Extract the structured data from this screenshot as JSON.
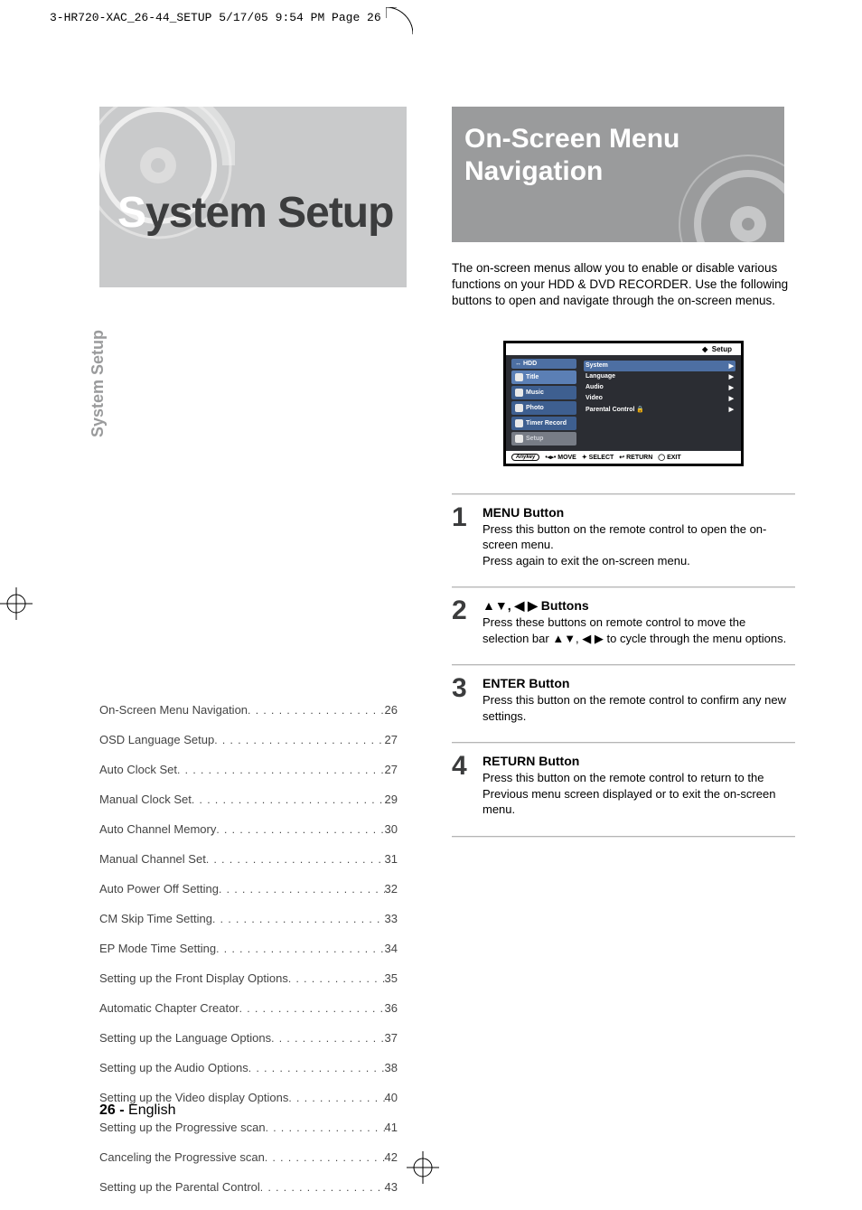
{
  "doc_header": "3-HR720-XAC_26-44_SETUP  5/17/05  9:54 PM  Page 26",
  "hero": {
    "s": "S",
    "rest": "ystem Setup"
  },
  "side_tab": "System Setup",
  "toc": [
    {
      "label": "On-Screen Menu Navigation",
      "page": "26"
    },
    {
      "label": "OSD Language Setup",
      "page": "27"
    },
    {
      "label": "Auto Clock Set",
      "page": "27"
    },
    {
      "label": "Manual Clock Set",
      "page": "29"
    },
    {
      "label": "Auto Channel Memory",
      "page": "30"
    },
    {
      "label": "Manual Channel Set",
      "page": "31"
    },
    {
      "label": "Auto Power Off Setting",
      "page": "32"
    },
    {
      "label": "CM Skip Time Setting",
      "page": "33"
    },
    {
      "label": "EP Mode Time Setting",
      "page": "34"
    },
    {
      "label": "Setting up the Front Display Options",
      "page": "35"
    },
    {
      "label": "Automatic Chapter Creator",
      "page": "36"
    },
    {
      "label": "Setting up the Language Options",
      "page": "37"
    },
    {
      "label": "Setting up the Audio Options",
      "page": "38"
    },
    {
      "label": "Setting up the Video display Options",
      "page": "40"
    },
    {
      "label": "Setting up the Progressive scan",
      "page": "41"
    },
    {
      "label": "Canceling the Progressive scan",
      "page": "42"
    },
    {
      "label": "Setting up the Parental Control",
      "page": "43"
    }
  ],
  "footer": {
    "page": "26 -",
    "lang": "English"
  },
  "right_hero": {
    "line1": "On-Screen Menu",
    "line2": "Navigation"
  },
  "intro": "The on-screen menus allow you to enable or disable various functions on your HDD & DVD RECORDER. Use the following buttons to open and navigate through the on-screen menus.",
  "osd": {
    "top_label": "Setup",
    "top_bullet": "◆",
    "hdd": "HDD",
    "nav": [
      {
        "label": "Title"
      },
      {
        "label": "Music"
      },
      {
        "label": "Photo"
      },
      {
        "label": "Timer Record"
      },
      {
        "label": "Setup"
      }
    ],
    "main": [
      {
        "label": "System",
        "lock": false
      },
      {
        "label": "Language",
        "lock": false
      },
      {
        "label": "Audio",
        "lock": false
      },
      {
        "label": "Video",
        "lock": false
      },
      {
        "label": "Parental Control",
        "lock": true
      }
    ],
    "footer": {
      "chip": "Anykey",
      "move": "MOVE",
      "select": "SELECT",
      "return": "RETURN",
      "exit": "EXIT"
    }
  },
  "steps": [
    {
      "num": "1",
      "title": "MENU Button",
      "body": "Press this button on the remote control to open the on-screen menu.\nPress again to exit the on-screen menu."
    },
    {
      "num": "2",
      "title": "▲▼, ◀ ▶ Buttons",
      "body": "Press these buttons on remote control to move the selection bar ▲▼, ◀ ▶ to cycle through the menu options."
    },
    {
      "num": "3",
      "title": "ENTER Button",
      "body": "Press this button on the remote control to confirm any new settings."
    },
    {
      "num": "4",
      "title": "RETURN Button",
      "body": "Press this button on the remote control to return to the Previous menu screen displayed or to exit the on-screen menu."
    }
  ]
}
